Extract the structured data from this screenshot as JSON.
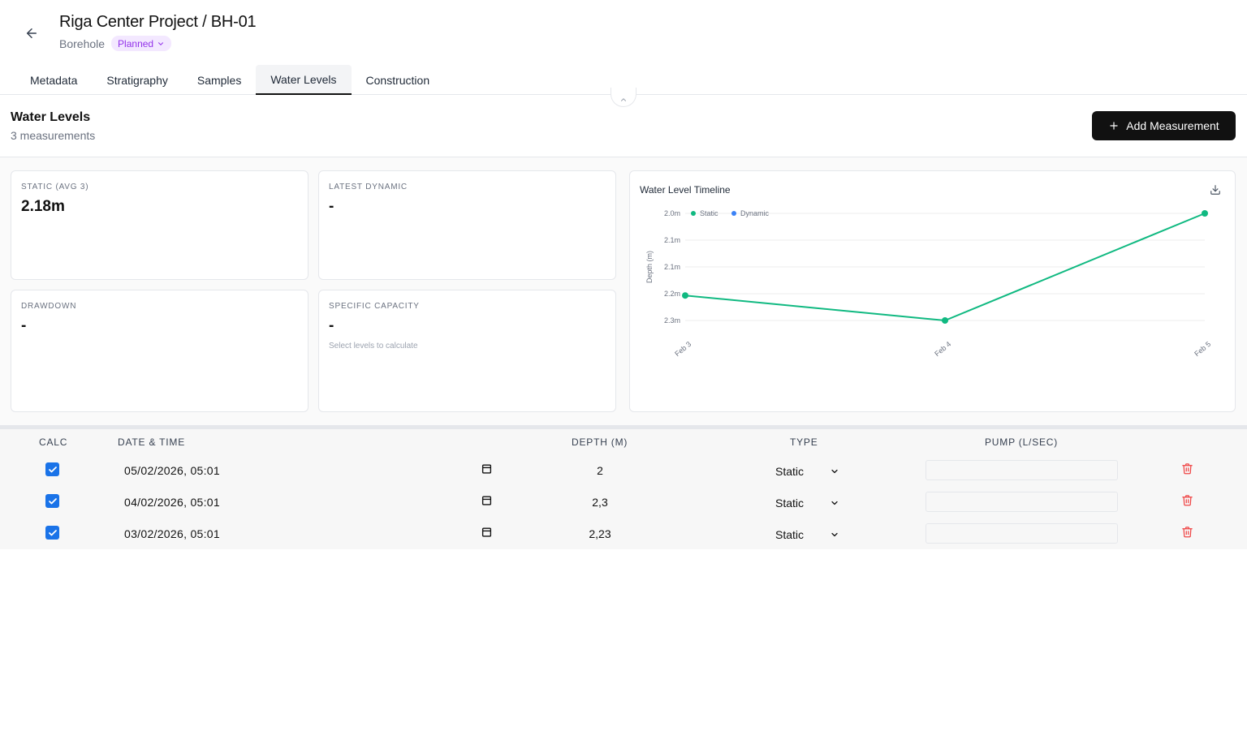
{
  "header": {
    "title": "Riga Center Project / BH-01",
    "subtitle": "Borehole",
    "status_badge": "Planned"
  },
  "tabs": [
    {
      "label": "Metadata",
      "active": false
    },
    {
      "label": "Stratigraphy",
      "active": false
    },
    {
      "label": "Samples",
      "active": false
    },
    {
      "label": "Water Levels",
      "active": true
    },
    {
      "label": "Construction",
      "active": false
    }
  ],
  "section": {
    "title": "Water Levels",
    "count": "3 measurements",
    "add_button": "Add Measurement"
  },
  "stats": {
    "static": {
      "label": "STATIC (AVG 3)",
      "value": "2.18m"
    },
    "latest_dynamic": {
      "label": "LATEST DYNAMIC",
      "value": "-"
    },
    "drawdown": {
      "label": "DRAWDOWN",
      "value": "-"
    },
    "specific_capacity": {
      "label": "SPECIFIC CAPACITY",
      "value": "-",
      "hint": "Select levels to calculate"
    }
  },
  "chart": {
    "title": "Water Level Timeline",
    "icon": "download-icon"
  },
  "chart_data": {
    "type": "line",
    "title": "Water Level Timeline",
    "ylabel": "Depth (m)",
    "xlabel": "",
    "y_inverted": true,
    "ylim": [
      2.0,
      2.3
    ],
    "yticks": [
      2.0,
      2.075,
      2.15,
      2.225,
      2.3
    ],
    "ytick_labels": [
      "2.0m",
      "2.1m",
      "2.1m",
      "2.2m",
      "2.3m"
    ],
    "categories": [
      "Feb 3",
      "Feb 4",
      "Feb 5"
    ],
    "legend": "top-left",
    "grid": true,
    "series": [
      {
        "name": "Static",
        "color": "#10b981",
        "values": [
          2.23,
          2.3,
          2.0
        ]
      },
      {
        "name": "Dynamic",
        "color": "#3b82f6",
        "values": []
      }
    ]
  },
  "table": {
    "headers": {
      "calc": "CALC",
      "datetime": "DATE & TIME",
      "depth": "DEPTH (M)",
      "type": "TYPE",
      "pump": "PUMP (L/SEC)"
    },
    "rows": [
      {
        "checked": true,
        "datetime": "05/02/2026, 05:01",
        "depth": "2",
        "type": "Static",
        "pump": ""
      },
      {
        "checked": true,
        "datetime": "04/02/2026, 05:01",
        "depth": "2,3",
        "type": "Static",
        "pump": ""
      },
      {
        "checked": true,
        "datetime": "03/02/2026, 05:01",
        "depth": "2,23",
        "type": "Static",
        "pump": ""
      }
    ]
  },
  "colors": {
    "accent": "#111111",
    "badge_bg": "#f3e8ff",
    "badge_text": "#9333ea",
    "static_series": "#10b981",
    "dynamic_series": "#3b82f6",
    "delete": "#ef4444",
    "checkbox": "#1a73e8"
  }
}
